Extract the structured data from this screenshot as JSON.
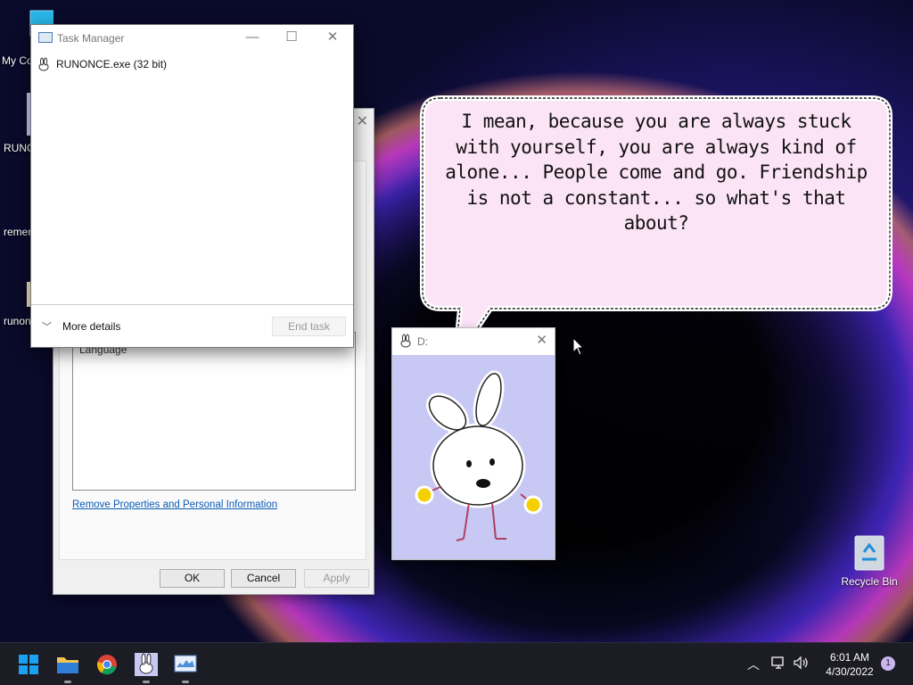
{
  "desktop": {
    "icons": [
      {
        "label": "My Co",
        "icon": "monitor-icon"
      },
      {
        "label": "RUNC",
        "icon": "rabbit-icon"
      },
      {
        "label": "remen",
        "icon": "folder-icon"
      },
      {
        "label": "runon",
        "icon": "rabbit-small-icon"
      }
    ],
    "recycle_bin": {
      "label": "Recycle Bin",
      "icon": "recycle-bin-icon"
    }
  },
  "properties_dialog": {
    "list_item": "Language",
    "remove_link": "Remove Properties and Personal Information",
    "buttons": {
      "ok": "OK",
      "cancel": "Cancel",
      "apply": "Apply"
    }
  },
  "task_manager": {
    "title": "Task Manager",
    "process": "RUNONCE.exe (32 bit)",
    "more_details": "More details",
    "end_task": "End task"
  },
  "bubble": {
    "text": "I mean, because you are always stuck with yourself, you are always kind of alone... People come and go. Friendship is not a constant... so what's that about?"
  },
  "d_window": {
    "title": "D:"
  },
  "taskbar": {
    "apps": [
      {
        "name": "start",
        "icon": "windows-start-icon"
      },
      {
        "name": "file-explorer",
        "icon": "folder-icon"
      },
      {
        "name": "chrome",
        "icon": "chrome-icon"
      },
      {
        "name": "runonce",
        "icon": "rabbit-icon"
      },
      {
        "name": "task-manager",
        "icon": "task-manager-icon"
      }
    ],
    "clock": {
      "time": "6:01 AM",
      "date": "4/30/2022"
    },
    "notifications": "1"
  },
  "colors": {
    "bubble_fill": "#fce4f7",
    "d_canvas": "#c8c8f5",
    "link": "#0a5cb8",
    "taskbar": "#1c1c24"
  }
}
